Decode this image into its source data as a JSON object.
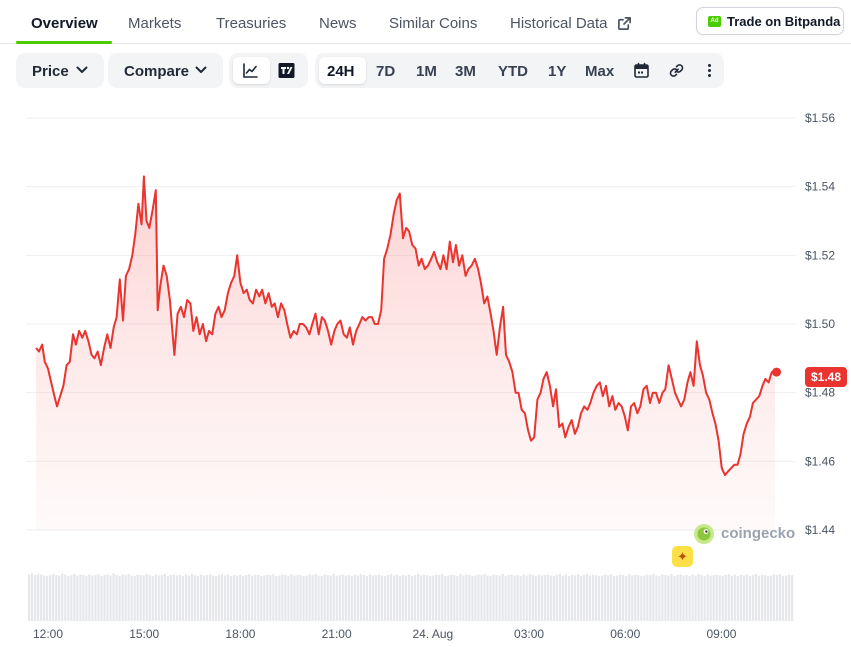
{
  "tabs": [
    "Overview",
    "Markets",
    "Treasuries",
    "News",
    "Similar Coins",
    "Historical Data"
  ],
  "trade_button": {
    "badge": "Ad",
    "label": "Trade on Bitpanda"
  },
  "toolbar": {
    "price_dropdown": "Price",
    "compare_dropdown": "Compare",
    "ranges": [
      "24H",
      "7D",
      "1M",
      "3M",
      "YTD",
      "1Y",
      "Max"
    ],
    "active_range": "24H",
    "icons": [
      "line-chart-icon",
      "tradingview-icon",
      "calendar-icon",
      "link-icon",
      "more-icon"
    ]
  },
  "watermark": "coingecko",
  "current_price_label": "$1.48",
  "colors": {
    "line": "#e9342f",
    "accent_tab": "#4bcc00",
    "price_tag": "#e9342f"
  },
  "chart_data": {
    "type": "area",
    "title": "",
    "xlabel": "",
    "ylabel": "",
    "x_ticks": [
      "12:00",
      "15:00",
      "18:00",
      "21:00",
      "24. Aug",
      "03:00",
      "06:00",
      "09:00"
    ],
    "x_tick_hours": [
      12,
      15,
      18,
      21,
      24,
      27,
      30,
      33
    ],
    "y_ticks": [
      "$1.44",
      "$1.46",
      "$1.48",
      "$1.50",
      "$1.52",
      "$1.54",
      "$1.56"
    ],
    "ylim": [
      1.44,
      1.56
    ],
    "grid": true,
    "series": [
      {
        "values": [
          [
            11.63,
            1.493
          ],
          [
            11.72,
            1.492
          ],
          [
            11.82,
            1.494
          ],
          [
            11.9,
            1.489
          ],
          [
            12.0,
            1.487
          ],
          [
            12.1,
            1.483
          ],
          [
            12.2,
            1.479
          ],
          [
            12.28,
            1.476
          ],
          [
            12.38,
            1.479
          ],
          [
            12.48,
            1.482
          ],
          [
            12.58,
            1.488
          ],
          [
            12.68,
            1.489
          ],
          [
            12.78,
            1.497
          ],
          [
            12.87,
            1.494
          ],
          [
            12.97,
            1.498
          ],
          [
            13.07,
            1.496
          ],
          [
            13.16,
            1.498
          ],
          [
            13.26,
            1.495
          ],
          [
            13.36,
            1.491
          ],
          [
            13.45,
            1.49
          ],
          [
            13.55,
            1.492
          ],
          [
            13.65,
            1.488
          ],
          [
            13.75,
            1.493
          ],
          [
            13.85,
            1.497
          ],
          [
            13.95,
            1.493
          ],
          [
            14.05,
            1.499
          ],
          [
            14.14,
            1.502
          ],
          [
            14.24,
            1.513
          ],
          [
            14.34,
            1.501
          ],
          [
            14.43,
            1.514
          ],
          [
            14.53,
            1.516
          ],
          [
            14.63,
            1.52
          ],
          [
            14.72,
            1.526
          ],
          [
            14.82,
            1.535
          ],
          [
            14.92,
            1.529
          ],
          [
            14.99,
            1.543
          ],
          [
            15.07,
            1.53
          ],
          [
            15.16,
            1.528
          ],
          [
            15.26,
            1.533
          ],
          [
            15.36,
            1.539
          ],
          [
            15.42,
            1.504
          ],
          [
            15.5,
            1.511
          ],
          [
            15.6,
            1.517
          ],
          [
            15.7,
            1.514
          ],
          [
            15.8,
            1.507
          ],
          [
            15.86,
            1.5
          ],
          [
            15.94,
            1.491
          ],
          [
            16.04,
            1.503
          ],
          [
            16.14,
            1.505
          ],
          [
            16.24,
            1.502
          ],
          [
            16.34,
            1.507
          ],
          [
            16.44,
            1.506
          ],
          [
            16.53,
            1.498
          ],
          [
            16.63,
            1.502
          ],
          [
            16.73,
            1.497
          ],
          [
            16.83,
            1.5
          ],
          [
            16.93,
            1.495
          ],
          [
            17.02,
            1.498
          ],
          [
            17.12,
            1.497
          ],
          [
            17.22,
            1.503
          ],
          [
            17.32,
            1.505
          ],
          [
            17.41,
            1.502
          ],
          [
            17.51,
            1.504
          ],
          [
            17.61,
            1.509
          ],
          [
            17.71,
            1.512
          ],
          [
            17.81,
            1.514
          ],
          [
            17.9,
            1.52
          ],
          [
            18.0,
            1.512
          ],
          [
            18.1,
            1.509
          ],
          [
            18.2,
            1.51
          ],
          [
            18.29,
            1.507
          ],
          [
            18.39,
            1.506
          ],
          [
            18.49,
            1.51
          ],
          [
            18.59,
            1.508
          ],
          [
            18.68,
            1.51
          ],
          [
            18.78,
            1.506
          ],
          [
            18.88,
            1.509
          ],
          [
            18.98,
            1.505
          ],
          [
            19.07,
            1.506
          ],
          [
            19.17,
            1.502
          ],
          [
            19.27,
            1.506
          ],
          [
            19.37,
            1.504
          ],
          [
            19.46,
            1.5
          ],
          [
            19.56,
            1.496
          ],
          [
            19.66,
            1.498
          ],
          [
            19.76,
            1.497
          ],
          [
            19.85,
            1.5
          ],
          [
            19.95,
            1.5
          ],
          [
            20.05,
            1.499
          ],
          [
            20.15,
            1.497
          ],
          [
            20.24,
            1.5
          ],
          [
            20.34,
            1.503
          ],
          [
            20.44,
            1.497
          ],
          [
            20.54,
            1.502
          ],
          [
            20.63,
            1.501
          ],
          [
            20.73,
            1.498
          ],
          [
            20.83,
            1.494
          ],
          [
            20.93,
            1.498
          ],
          [
            21.02,
            1.5
          ],
          [
            21.12,
            1.501
          ],
          [
            21.22,
            1.497
          ],
          [
            21.32,
            1.496
          ],
          [
            21.41,
            1.499
          ],
          [
            21.51,
            1.494
          ],
          [
            21.61,
            1.498
          ],
          [
            21.71,
            1.5
          ],
          [
            21.8,
            1.502
          ],
          [
            21.9,
            1.501
          ],
          [
            22.0,
            1.502
          ],
          [
            22.1,
            1.502
          ],
          [
            22.19,
            1.5
          ],
          [
            22.29,
            1.5
          ],
          [
            22.39,
            1.504
          ],
          [
            22.48,
            1.519
          ],
          [
            22.58,
            1.522
          ],
          [
            22.68,
            1.526
          ],
          [
            22.78,
            1.532
          ],
          [
            22.87,
            1.536
          ],
          [
            22.97,
            1.538
          ],
          [
            23.07,
            1.525
          ],
          [
            23.17,
            1.528
          ],
          [
            23.26,
            1.527
          ],
          [
            23.36,
            1.523
          ],
          [
            23.46,
            1.522
          ],
          [
            23.56,
            1.517
          ],
          [
            23.65,
            1.519
          ],
          [
            23.75,
            1.516
          ],
          [
            23.85,
            1.517
          ],
          [
            23.95,
            1.519
          ],
          [
            24.04,
            1.521
          ],
          [
            24.14,
            1.518
          ],
          [
            24.24,
            1.516
          ],
          [
            24.33,
            1.52
          ],
          [
            24.43,
            1.516
          ],
          [
            24.53,
            1.524
          ],
          [
            24.63,
            1.518
          ],
          [
            24.72,
            1.523
          ],
          [
            24.82,
            1.517
          ],
          [
            24.92,
            1.52
          ],
          [
            25.02,
            1.514
          ],
          [
            25.11,
            1.516
          ],
          [
            25.21,
            1.517
          ],
          [
            25.31,
            1.519
          ],
          [
            25.41,
            1.516
          ],
          [
            25.5,
            1.512
          ],
          [
            25.6,
            1.506
          ],
          [
            25.7,
            1.508
          ],
          [
            25.8,
            1.503
          ],
          [
            25.89,
            1.498
          ],
          [
            25.99,
            1.491
          ],
          [
            26.09,
            1.499
          ],
          [
            26.19,
            1.505
          ],
          [
            26.28,
            1.491
          ],
          [
            26.38,
            1.489
          ],
          [
            26.48,
            1.486
          ],
          [
            26.58,
            1.48
          ],
          [
            26.67,
            1.48
          ],
          [
            26.77,
            1.475
          ],
          [
            26.87,
            1.474
          ],
          [
            26.97,
            1.469
          ],
          [
            27.06,
            1.466
          ],
          [
            27.16,
            1.467
          ],
          [
            27.26,
            1.478
          ],
          [
            27.36,
            1.48
          ],
          [
            27.45,
            1.484
          ],
          [
            27.55,
            1.486
          ],
          [
            27.65,
            1.482
          ],
          [
            27.75,
            1.476
          ],
          [
            27.84,
            1.481
          ],
          [
            27.94,
            1.47
          ],
          [
            28.04,
            1.471
          ],
          [
            28.13,
            1.467
          ],
          [
            28.23,
            1.47
          ],
          [
            28.33,
            1.472
          ],
          [
            28.43,
            1.468
          ],
          [
            28.52,
            1.47
          ],
          [
            28.62,
            1.474
          ],
          [
            28.72,
            1.476
          ],
          [
            28.82,
            1.475
          ],
          [
            28.91,
            1.477
          ],
          [
            29.01,
            1.48
          ],
          [
            29.11,
            1.482
          ],
          [
            29.21,
            1.483
          ],
          [
            29.3,
            1.479
          ],
          [
            29.4,
            1.482
          ],
          [
            29.5,
            1.476
          ],
          [
            29.6,
            1.479
          ],
          [
            29.69,
            1.475
          ],
          [
            29.79,
            1.477
          ],
          [
            29.89,
            1.476
          ],
          [
            29.99,
            1.473
          ],
          [
            30.08,
            1.469
          ],
          [
            30.18,
            1.476
          ],
          [
            30.28,
            1.477
          ],
          [
            30.38,
            1.474
          ],
          [
            30.47,
            1.476
          ],
          [
            30.57,
            1.481
          ],
          [
            30.67,
            1.482
          ],
          [
            30.77,
            1.477
          ],
          [
            30.86,
            1.48
          ],
          [
            30.96,
            1.48
          ],
          [
            31.06,
            1.477
          ],
          [
            31.16,
            1.48
          ],
          [
            31.25,
            1.481
          ],
          [
            31.35,
            1.488
          ],
          [
            31.45,
            1.484
          ],
          [
            31.55,
            1.48
          ],
          [
            31.64,
            1.478
          ],
          [
            31.74,
            1.476
          ],
          [
            31.84,
            1.478
          ],
          [
            31.94,
            1.483
          ],
          [
            32.03,
            1.486
          ],
          [
            32.13,
            1.482
          ],
          [
            32.23,
            1.495
          ],
          [
            32.33,
            1.488
          ],
          [
            32.42,
            1.485
          ],
          [
            32.52,
            1.48
          ],
          [
            32.62,
            1.478
          ],
          [
            32.72,
            1.474
          ],
          [
            32.81,
            1.471
          ],
          [
            32.91,
            1.466
          ],
          [
            33.01,
            1.458
          ],
          [
            33.11,
            1.456
          ],
          [
            33.2,
            1.457
          ],
          [
            33.3,
            1.458
          ],
          [
            33.4,
            1.459
          ],
          [
            33.5,
            1.459
          ],
          [
            33.59,
            1.462
          ],
          [
            33.69,
            1.468
          ],
          [
            33.79,
            1.471
          ],
          [
            33.89,
            1.473
          ],
          [
            33.98,
            1.477
          ],
          [
            34.08,
            1.478
          ],
          [
            34.18,
            1.479
          ],
          [
            34.28,
            1.482
          ],
          [
            34.37,
            1.484
          ],
          [
            34.47,
            1.483
          ],
          [
            34.57,
            1.486
          ],
          [
            34.67,
            1.486
          ]
        ]
      }
    ],
    "volume": [
      0.93,
      0.95,
      0.92,
      0.94,
      0.93,
      0.91,
      0.9,
      0.92,
      0.94,
      0.92,
      0.91,
      0.95,
      0.93,
      0.9,
      0.92,
      0.94,
      0.91,
      0.93,
      0.92,
      0.9,
      0.93,
      0.91,
      0.92,
      0.94,
      0.9,
      0.92,
      0.93,
      0.91,
      0.95,
      0.92,
      0.9,
      0.93,
      0.92,
      0.94,
      0.91,
      0.9,
      0.93,
      0.92,
      0.91,
      0.94,
      0.92,
      0.9,
      0.93,
      0.91,
      0.92,
      0.94,
      0.9,
      0.92,
      0.93,
      0.91,
      0.92,
      0.9,
      0.93,
      0.91,
      0.94,
      0.92,
      0.9,
      0.93,
      0.91,
      0.92,
      0.93,
      0.91,
      0.9,
      0.92,
      0.94,
      0.91,
      0.93,
      0.9,
      0.92,
      0.91,
      0.93,
      0.9,
      0.92,
      0.94,
      0.91,
      0.93,
      0.92,
      0.9,
      0.91,
      0.93,
      0.92,
      0.94,
      0.9,
      0.91,
      0.93,
      0.92,
      0.9,
      0.94,
      0.91,
      0.93,
      0.92,
      0.9,
      0.91,
      0.93,
      0.92,
      0.94,
      0.91,
      0.9,
      0.93,
      0.92,
      0.91,
      0.94,
      0.9,
      0.92,
      0.93,
      0.91,
      0.92,
      0.9,
      0.93,
      0.91,
      0.94,
      0.92,
      0.9,
      0.93,
      0.91,
      0.92,
      0.93,
      0.91,
      0.9,
      0.92,
      0.94,
      0.91,
      0.93,
      0.9,
      0.92,
      0.91,
      0.93,
      0.9,
      0.92,
      0.94,
      0.91,
      0.93,
      0.92,
      0.9,
      0.91,
      0.93,
      0.92,
      0.94,
      0.9,
      0.91,
      0.93,
      0.92,
      0.9,
      0.94,
      0.91,
      0.93,
      0.92,
      0.9,
      0.91,
      0.93,
      0.92,
      0.94,
      0.91,
      0.9,
      0.93,
      0.92,
      0.91,
      0.94,
      0.9,
      0.92,
      0.93,
      0.91,
      0.92,
      0.9,
      0.93,
      0.91,
      0.94,
      0.92,
      0.9,
      0.93,
      0.91,
      0.92,
      0.93,
      0.91,
      0.9,
      0.92,
      0.94,
      0.91,
      0.93,
      0.9,
      0.92,
      0.91,
      0.93,
      0.9,
      0.92,
      0.94,
      0.91,
      0.93,
      0.92,
      0.9,
      0.91,
      0.93,
      0.92,
      0.94,
      0.9,
      0.91,
      0.93,
      0.92,
      0.9,
      0.94,
      0.91,
      0.93,
      0.92,
      0.9,
      0.91,
      0.93,
      0.92,
      0.94,
      0.91,
      0.9,
      0.93,
      0.92,
      0.91,
      0.94,
      0.9,
      0.92,
      0.93,
      0.91,
      0.92,
      0.9,
      0.93,
      0.91,
      0.94,
      0.92,
      0.9,
      0.93,
      0.91,
      0.92,
      0.93,
      0.91,
      0.9,
      0.92,
      0.94,
      0.91,
      0.93,
      0.9,
      0.92,
      0.91,
      0.93,
      0.9,
      0.92,
      0.94,
      0.91,
      0.93,
      0.92,
      0.9,
      0.91,
      0.93,
      0.92,
      0.94,
      0.9,
      0.91,
      0.93,
      0.92
    ]
  }
}
